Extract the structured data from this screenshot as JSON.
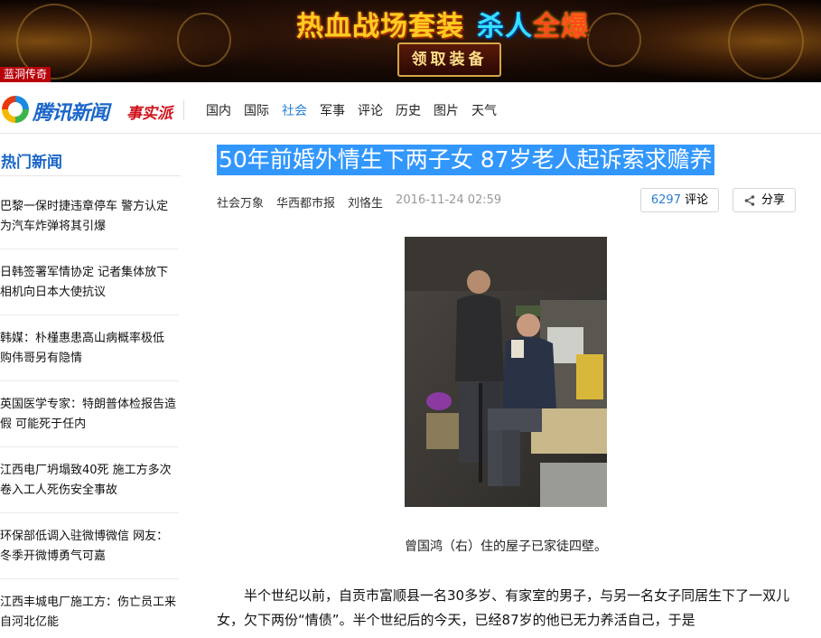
{
  "banner": {
    "headline_a": "热血战场套装",
    "headline_b": "杀人",
    "headline_c": "全爆",
    "claim_button": "领取装备",
    "tag": "蓝洞传奇"
  },
  "header": {
    "logo_name": "腾讯新闻",
    "logo_sub": "事实派",
    "nav": [
      "国内",
      "国际",
      "社会",
      "军事",
      "评论",
      "历史",
      "图片",
      "天气"
    ],
    "active_nav": "社会",
    "accent_color": "#2a7fd4"
  },
  "sidebar": {
    "title": "热门新闻",
    "items": [
      "巴黎一保时捷违章停车 警方认定为汽车炸弹将其引爆",
      "日韩签署军情协定 记者集体放下相机向日本大使抗议",
      "韩媒：朴槿惠患高山病概率极低 购伟哥另有隐情",
      "英国医学专家：特朗普体检报告造假 可能死于任内",
      "江西电厂坍塌致40死 施工方多次卷入工人死伤安全事故",
      "环保部低调入驻微博微信 网友：冬季开微博勇气可嘉",
      "江西丰城电厂施工方：伤亡员工来自河北亿能"
    ]
  },
  "article": {
    "title": "50年前婚外情生下两子女 87岁老人起诉索求赡养",
    "category": "社会万象",
    "source": "华西都市报",
    "author": "刘恪生",
    "date": "2016-11-24 02:59",
    "comment_count": "6297",
    "comment_label": "评论",
    "share_label": "分享",
    "caption": "曾国鸿（右）住的屋子已家徒四壁。",
    "paragraph": "半个世纪以前，自贡市富顺县一名30多岁、有家室的男子，与另一名女子同居生下了一双儿女，欠下两份“情债”。半个世纪后的今天，已经87岁的他已无力养活自己，于是"
  }
}
